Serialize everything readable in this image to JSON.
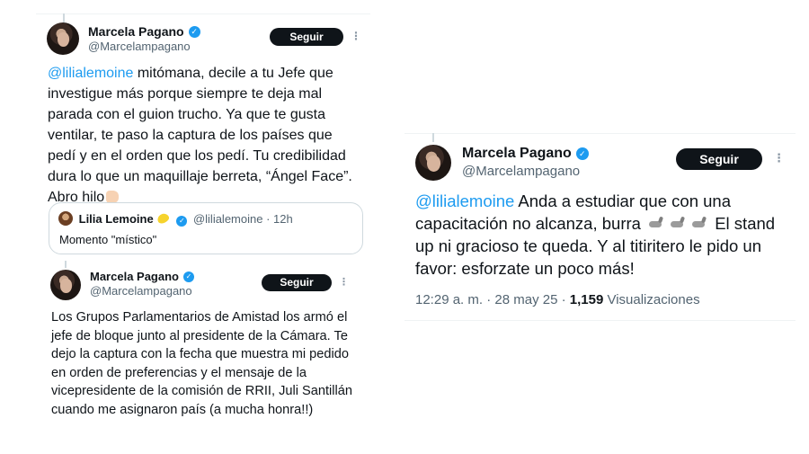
{
  "tweet1": {
    "author_name": "Marcela Pagano",
    "author_handle": "@Marcelampagano",
    "follow_label": "Seguir",
    "more_label": "⋮",
    "mention": "@lilialemoine",
    "body": " mitómana, decile a tu Jefe que investigue más porque siempre te deja mal parada con el guion trucho. Ya que te gusta ventilar, te paso la captura de los países que pedí y en el orden que los pedí. Tu credibilidad dura lo que un maquillaje berreta, “Ángel Face”. Abro hilo",
    "quote": {
      "author_name": "Lilia Lemoine",
      "author_handle": "@lilialemoine",
      "time": "· 12h",
      "text": "Momento \"místico\""
    }
  },
  "tweet2": {
    "author_name": "Marcela Pagano",
    "author_handle": "@Marcelampagano",
    "follow_label": "Seguir",
    "more_label": "⋮",
    "body": "Los Grupos Parlamentarios de Amistad los armó el jefe de bloque junto al presidente de la Cámara. Te dejo la captura con la fecha que muestra mi pedido en orden de preferencias y el mensaje de la vicepresidente de la comisión de RRII, Juli Santillán cuando me asignaron país (a mucha honra!!)"
  },
  "tweet3": {
    "author_name": "Marcela Pagano",
    "author_handle": "@Marcelampagano",
    "follow_label": "Seguir",
    "more_label": "⋮",
    "mention": "@lilialemoine",
    "body_part1": " Anda a estudiar que con una capacitación no alcanza, burra ",
    "body_part2": " El stand up ni gracioso te queda. Y al titiritero le pido un favor: esforzate un poco más!",
    "timestamp": "12:29 a. m. · 28 may 25 · ",
    "views_count": "1,159",
    "views_label": " Visualizaciones"
  },
  "colors": {
    "accent": "#1d9bf0",
    "text": "#0f1419",
    "secondary": "#536471",
    "button": "#0f1419"
  },
  "icons": [
    "verified-badge-icon",
    "more-icon",
    "hand-pointing-icon",
    "lemon-icon",
    "donkey-icon"
  ]
}
